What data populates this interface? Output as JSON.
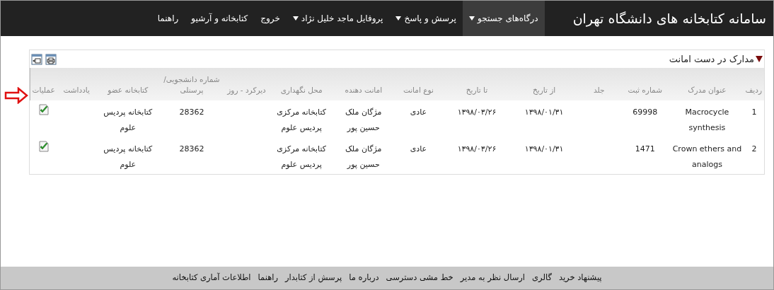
{
  "navbar": {
    "brand": "سامانه کتابخانه های دانشگاه تهران",
    "menu": [
      {
        "label": "درگاه‌های جستجو",
        "dropdown": true,
        "selected": true
      },
      {
        "label": "پرسش و پاسخ",
        "dropdown": true,
        "selected": false
      },
      {
        "label": "پروفایل ماجد خلیل نژاد",
        "dropdown": true,
        "selected": false
      },
      {
        "label": "خروج",
        "dropdown": false,
        "selected": false
      },
      {
        "label": "کتابخانه و آرشیو",
        "dropdown": false,
        "selected": false
      },
      {
        "label": "راهنما",
        "dropdown": false,
        "selected": false
      }
    ]
  },
  "panel": {
    "title": "مدارک در دست امانت",
    "expanded": true,
    "table": {
      "columns": [
        "ردیف",
        "عنوان مدرک",
        "شماره ثبت",
        "جلد",
        "از تاریخ",
        "تا تاریخ",
        "نوع امانت",
        "امانت دهنده",
        "محل نگهداری",
        "دیرکرد - روز",
        "شماره دانشجویی/ پرسنلی",
        "کتابخانه عضو",
        "یادداشت",
        "عملیات"
      ],
      "rows": [
        {
          "cells": [
            "1",
            "Macrocycle synthesis",
            "69998",
            "",
            "۱۳۹۸/۰۱/۳۱",
            "۱۳۹۸/۰۳/۲۶",
            "عادی",
            "مژگان ملک حسین پور",
            "کتابخانه مرکزی پردیس علوم",
            "",
            "28362",
            "کتابخانه پردیس علوم",
            ""
          ]
        },
        {
          "cells": [
            "2",
            "Crown ethers and analogs",
            "1471",
            "",
            "۱۳۹۸/۰۱/۳۱",
            "۱۳۹۸/۰۳/۲۶",
            "عادی",
            "مژگان ملک حسین پور",
            "کتابخانه مرکزی پردیس علوم",
            "",
            "28362",
            "کتابخانه پردیس علوم",
            ""
          ]
        }
      ]
    }
  },
  "footer": {
    "links": [
      "پیشنهاد خرید",
      "گالری",
      "ارسال نظر به مدیر",
      "خط مشی دسترسی",
      "درباره ما",
      "پرسش از کتابدار",
      "راهنما",
      "اطلاعات آماری کتابخانه"
    ]
  }
}
